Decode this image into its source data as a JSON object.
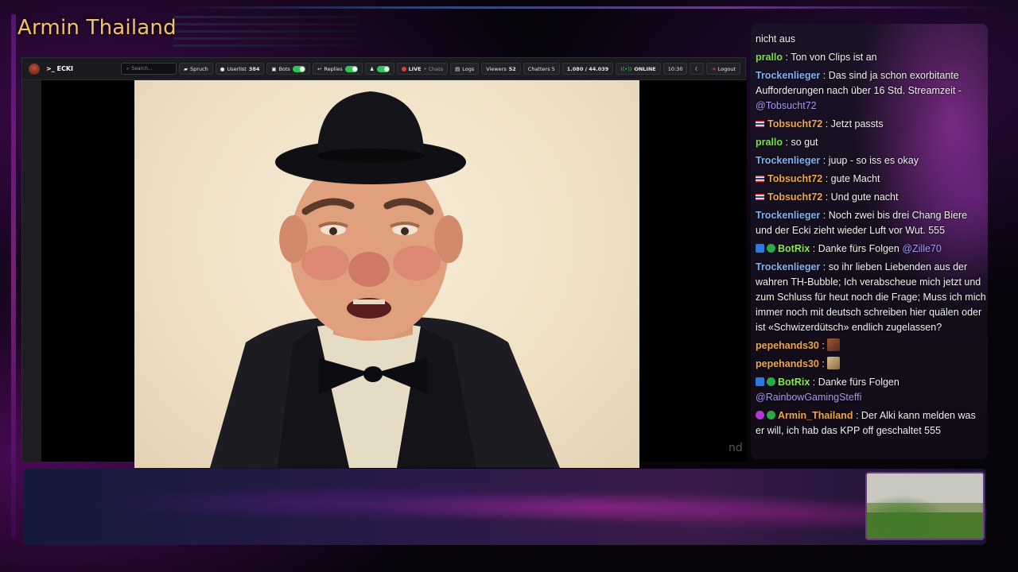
{
  "stream": {
    "title": "Armin Thailand"
  },
  "navbar": {
    "brand": ">_ ECKI",
    "search_placeholder": "Search...",
    "spruch": "Spruch",
    "userlist_label": "Userlist",
    "userlist_count": "384",
    "bots_label": "Bots",
    "replies_label": "Replies",
    "live_label": "LIVE",
    "live_sub": "• Chats",
    "logs_label": "Logs",
    "viewers_label": "Viewers",
    "viewers_count": "52",
    "chatters_label": "Chatters 5",
    "counter": "1.080 / 44.039",
    "online_label": "ONLINE",
    "time": "10:30",
    "logout_label": "Logout"
  },
  "video": {
    "overlay_text": "nd"
  },
  "chat": {
    "messages": [
      {
        "user": "",
        "text": "nicht aus"
      },
      {
        "user": "prallo",
        "sep": " : ",
        "text": "Ton von Clips ist an"
      },
      {
        "user": "Trockenlieger",
        "sep": " : ",
        "text": "Das sind ja schon exorbitante Aufforderungen nach über 16 Std. Streamzeit - ",
        "mention": "@Tobsucht72"
      },
      {
        "user": "Tobsucht72",
        "sep": " : ",
        "text": "Jetzt passts"
      },
      {
        "user": "prallo",
        "sep": " : ",
        "text": "so gut"
      },
      {
        "user": "Trockenlieger",
        "sep": " : ",
        "text": "juup - so iss es okay"
      },
      {
        "user": "Tobsucht72",
        "sep": " : ",
        "text": "gute Macht"
      },
      {
        "user": "Tobsucht72",
        "sep": " : ",
        "text": "Und gute nacht"
      },
      {
        "user": "Trockenlieger",
        "sep": " : ",
        "text": "Noch zwei bis drei Chang Biere und der Ecki zieht wieder Luft vor Wut. 555"
      },
      {
        "user": "BotRix",
        "sep": " : ",
        "text": "Danke fürs Folgen ",
        "mention": "@Zille70"
      },
      {
        "user": "Trockenlieger",
        "sep": " : ",
        "text": "so ihr lieben Liebenden aus der wahren TH-Bubble; Ich verabscheue mich jetzt und zum Schluss für heut noch die Frage; Muss ich mich immer noch mit deutsch schreiben hier quälen oder ist «Schwizerdütsch» endlich zugelassen?"
      },
      {
        "user": "pepehands30",
        "sep": " : "
      },
      {
        "user": "pepehands30",
        "sep": " : "
      },
      {
        "user": "BotRix",
        "sep": " : ",
        "text": "Danke fürs Folgen ",
        "mention": "@RainbowGamingSteffi"
      },
      {
        "user": "Armin_Thailand",
        "sep": " : ",
        "text": "Der Alki kann melden was er will, ich hab das KPP off geschaltet 555"
      }
    ]
  }
}
